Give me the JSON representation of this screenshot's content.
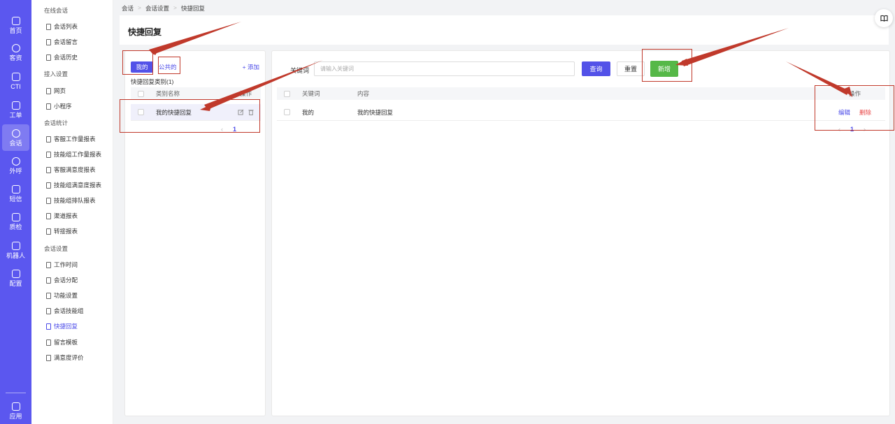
{
  "rail": {
    "items": [
      {
        "label": "首页",
        "icon": "home-icon"
      },
      {
        "label": "客资",
        "icon": "users-icon"
      },
      {
        "label": "CTI",
        "icon": "cti-icon"
      },
      {
        "label": "工单",
        "icon": "ticket-icon"
      },
      {
        "label": "会话",
        "icon": "chat-icon"
      },
      {
        "label": "外呼",
        "icon": "phone-icon"
      },
      {
        "label": "短信",
        "icon": "sms-icon"
      },
      {
        "label": "质检",
        "icon": "quality-icon"
      },
      {
        "label": "机器人",
        "icon": "robot-icon"
      },
      {
        "label": "配置",
        "icon": "settings-icon"
      }
    ],
    "apps_label": "应用"
  },
  "submenu": {
    "groups": [
      {
        "title": "在线会话",
        "items": [
          "会话列表",
          "会话留言",
          "会话历史"
        ]
      },
      {
        "title": "接入设置",
        "items": [
          "网页",
          "小程序"
        ]
      },
      {
        "title": "会话统计",
        "items": [
          "客服工作量报表",
          "技能组工作量报表",
          "客服满意度报表",
          "技能组满意度报表",
          "技能组排队报表",
          "渠道报表",
          "转接报表"
        ]
      },
      {
        "title": "会话设置",
        "items": [
          "工作时间",
          "会话分配",
          "功能设置",
          "会话技能组",
          "快捷回复",
          "留言模板",
          "满意度评价"
        ]
      }
    ]
  },
  "breadcrumb": [
    "会话",
    "会话设置",
    "快捷回复"
  ],
  "page_title": "快捷回复",
  "left_panel": {
    "tab_mine": "我的",
    "tab_public": "公共的",
    "add_label": "+ 添加",
    "category_count": "快捷回复类别(1)",
    "columns": {
      "name": "类别名称",
      "op": "操作"
    },
    "rows": [
      {
        "name": "我的快捷回复"
      }
    ],
    "page": "1"
  },
  "right_panel": {
    "keyword_label": "关键词",
    "keyword_placeholder": "请输入关键词",
    "query_label": "查询",
    "reset_label": "重置",
    "new_label": "新增",
    "columns": {
      "keyword": "关键词",
      "content": "内容",
      "op": "操作"
    },
    "rows": [
      {
        "keyword": "我的",
        "content": "我的快捷回复",
        "edit": "编辑",
        "delete": "删除"
      }
    ],
    "page": "1"
  },
  "colors": {
    "primary": "#5352e8",
    "rail": "#5b57ef",
    "success": "#56b848",
    "danger": "#e84545",
    "annotation": "#c0392b"
  }
}
